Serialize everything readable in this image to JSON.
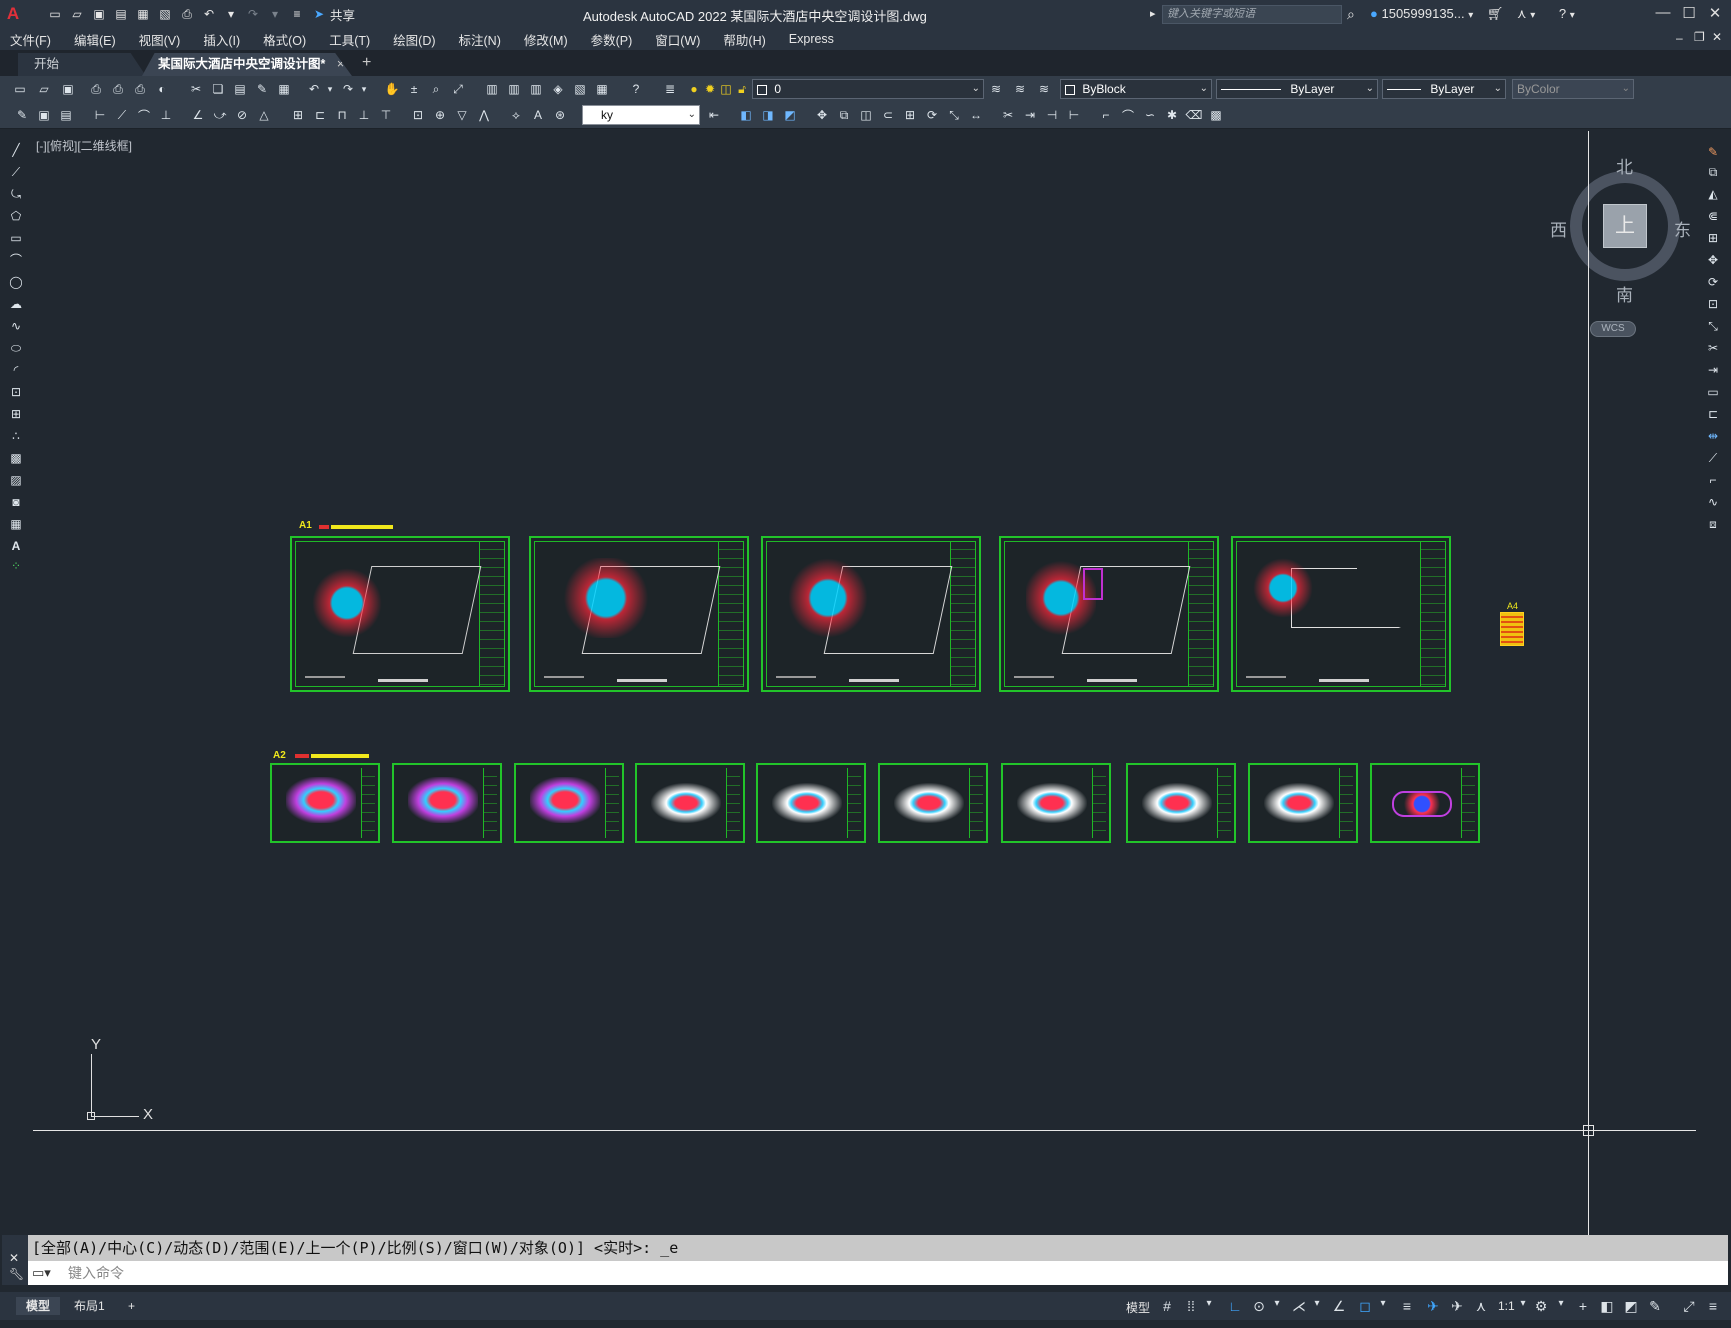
{
  "titlebar": {
    "title": "Autodesk AutoCAD 2022    某国际大酒店中央空调设计图.dwg",
    "share_label": "共享",
    "search_placeholder": "键入关键字或短语",
    "user_name": "1505999135...",
    "app_logo": "A"
  },
  "menubar": {
    "items": [
      "文件(F)",
      "编辑(E)",
      "视图(V)",
      "插入(I)",
      "格式(O)",
      "工具(T)",
      "绘图(D)",
      "标注(N)",
      "修改(M)",
      "参数(P)",
      "窗口(W)",
      "帮助(H)",
      "Express"
    ]
  },
  "tabs": {
    "start": "开始",
    "document": "某国际大酒店中央空调设计图*",
    "close_glyph": "×",
    "plus_glyph": "+"
  },
  "properties": {
    "layer_value": "0",
    "color_value": "ByBlock",
    "linetype_value": "ByLayer",
    "lineweight_value": "ByLayer",
    "plotstyle_value": "ByColor",
    "dimstyle_value": "ky"
  },
  "viewport": {
    "label": "[-][俯视][二维线框]",
    "viewcube": {
      "top": "上",
      "north": "北",
      "south": "南",
      "east": "东",
      "west": "西",
      "wcs": "WCS"
    },
    "ucs": {
      "x": "X",
      "y": "Y"
    },
    "group_labels": {
      "a1": "A1",
      "a2": "A2",
      "a4": "A4"
    }
  },
  "command": {
    "history": "[全部(A)/中心(C)/动态(D)/范围(E)/上一个(P)/比例(S)/窗口(W)/对象(O)] <实时>: _e",
    "input_placeholder": "键入命令"
  },
  "statusbar": {
    "model_tab": "模型",
    "layout_tab": "布局1",
    "add_tab": "+",
    "model_label": "模型",
    "scale_label": "1:1"
  },
  "colors": {
    "sheet_border": "#22c42a",
    "label_yellow": "#f0e81c",
    "background": "#212830",
    "accent_blue": "#3fa7ff"
  }
}
